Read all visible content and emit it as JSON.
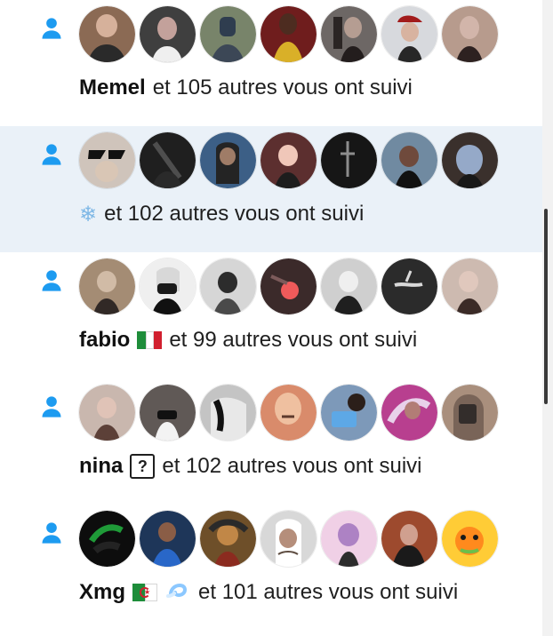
{
  "notifications": [
    {
      "name": "Memel",
      "text": "et 105 autres vous ont suivi",
      "avatars": [
        {
          "label": "avatar-1",
          "bg": "#8b6a54",
          "accent": "#2a2a2a"
        },
        {
          "label": "avatar-2",
          "bg": "#3f3f3f",
          "accent": "#efefef"
        },
        {
          "label": "avatar-3",
          "bg": "#78846a",
          "accent": "#2f3d4f"
        },
        {
          "label": "avatar-4",
          "bg": "#6f1d1d",
          "accent": "#d9b028"
        },
        {
          "label": "avatar-5",
          "bg": "#6d6765",
          "accent": "#2b2524"
        },
        {
          "label": "avatar-6",
          "bg": "#d7d9dd",
          "accent": "#a21b1b"
        },
        {
          "label": "avatar-7",
          "bg": "#b79b8d",
          "accent": "#2d2120"
        }
      ]
    },
    {
      "name": "❄",
      "text": "et 102 autres vous ont suivi",
      "avatars": [
        {
          "label": "avatar-1",
          "bg": "#cfc4bb",
          "accent": "#111111"
        },
        {
          "label": "avatar-2",
          "bg": "#1f1f1f",
          "accent": "#4e4e4e"
        },
        {
          "label": "avatar-3",
          "bg": "#3c5f86",
          "accent": "#242424"
        },
        {
          "label": "avatar-4",
          "bg": "#5c2f2f",
          "accent": "#f0c7b9"
        },
        {
          "label": "avatar-5",
          "bg": "#161616",
          "accent": "#8d8d8d"
        },
        {
          "label": "avatar-6",
          "bg": "#708aa1",
          "accent": "#111111"
        },
        {
          "label": "avatar-7",
          "bg": "#3a302c",
          "accent": "#95a9c8"
        }
      ]
    },
    {
      "name": "fabio",
      "text": "et 99 autres vous ont suivi",
      "avatars": [
        {
          "label": "avatar-1",
          "bg": "#a48c74",
          "accent": "#312926"
        },
        {
          "label": "avatar-2",
          "bg": "#efefef",
          "accent": "#1a1a1a"
        },
        {
          "label": "avatar-3",
          "bg": "#d6d6d6",
          "accent": "#2c2c2c"
        },
        {
          "label": "avatar-4",
          "bg": "#3b2a2a",
          "accent": "#ef5a5a"
        },
        {
          "label": "avatar-5",
          "bg": "#cfcfcf",
          "accent": "#1f1f1f"
        },
        {
          "label": "avatar-6",
          "bg": "#2b2b2b",
          "accent": "#d9d9d9"
        },
        {
          "label": "avatar-7",
          "bg": "#cdbab0",
          "accent": "#3b2b27"
        }
      ]
    },
    {
      "name": "nina",
      "text": "et 102 autres vous ont suivi",
      "avatars": [
        {
          "label": "avatar-1",
          "bg": "#c9b7ae",
          "accent": "#5c4038"
        },
        {
          "label": "avatar-2",
          "bg": "#605956",
          "accent": "#f3f3f3"
        },
        {
          "label": "avatar-3",
          "bg": "#c4c4c4",
          "accent": "#111111"
        },
        {
          "label": "avatar-4",
          "bg": "#d98b6b",
          "accent": "#5e3a2d"
        },
        {
          "label": "avatar-5",
          "bg": "#7d99b9",
          "accent": "#2b1f1a"
        },
        {
          "label": "avatar-6",
          "bg": "#b83f8f",
          "accent": "#e8d1ea"
        },
        {
          "label": "avatar-7",
          "bg": "#a98f7d",
          "accent": "#2a2a2a"
        }
      ]
    },
    {
      "name": "Xmg",
      "text": "et 101 autres vous ont suivi",
      "avatars": [
        {
          "label": "avatar-1",
          "bg": "#0d0d0d",
          "accent": "#1f9b38"
        },
        {
          "label": "avatar-2",
          "bg": "#1e3659",
          "accent": "#8a5d46"
        },
        {
          "label": "avatar-3",
          "bg": "#6e4f29",
          "accent": "#c18747"
        },
        {
          "label": "avatar-4",
          "bg": "#d8d8d8",
          "accent": "#5e4d41"
        },
        {
          "label": "avatar-5",
          "bg": "#f0d0e6",
          "accent": "#2c2c2c"
        },
        {
          "label": "avatar-6",
          "bg": "#9d4a2e",
          "accent": "#1a1a1a"
        },
        {
          "label": "avatar-7",
          "bg": "#ffcc36",
          "accent": "#6abf4b"
        }
      ]
    }
  ],
  "icons": {
    "follow": "person-icon",
    "flag_italy": "italy-flag-icon",
    "flag_algeria": "algeria-flag-icon",
    "dash": "dash-icon"
  },
  "colors": {
    "follow_icon": "#1d9bf0",
    "shaded_row": "#eaf1f8",
    "text": "#1f1f1f"
  }
}
